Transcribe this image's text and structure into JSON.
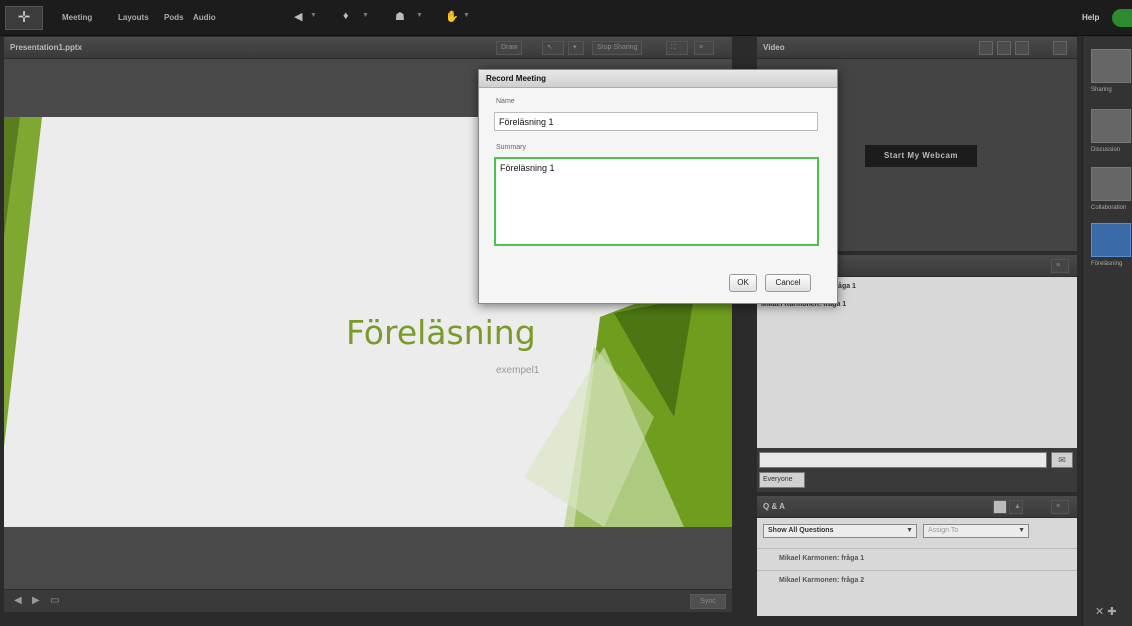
{
  "topbar": {
    "menus": [
      "Meeting",
      "Layouts",
      "Pods",
      "Audio"
    ],
    "help": "Help",
    "icons": [
      "speaker-icon",
      "microphone-icon",
      "webcam-icon",
      "raise-hand-icon"
    ]
  },
  "presentation": {
    "title": "Presentation1.pptx",
    "controls": [
      "Draw",
      "Stop Sharing",
      "Sync"
    ],
    "slide_title": "Föreläsning",
    "slide_subtitle": "exempel1",
    "accent_color": "#7a9a2a"
  },
  "video": {
    "title": "Video",
    "start_webcam": "Start My Webcam"
  },
  "chat": {
    "lines": [
      "fråga 1",
      "Mikael Karmonen: fråga 1"
    ],
    "tab": "Everyone"
  },
  "qa": {
    "title": "Q & A",
    "filter": "Show All Questions",
    "assign": "Assign To",
    "questions": [
      "Mikael Karmonen: fråga 1",
      "Mikael Karmonen: fråga 2"
    ]
  },
  "layouts": {
    "items": [
      "Sharing",
      "Discussion",
      "Collaboration",
      "Föreläsning"
    ],
    "active_color": "#3b6aa8"
  },
  "modal": {
    "title": "Record Meeting",
    "name_label": "Name",
    "name_value": "Föreläsning 1",
    "summary_label": "Summary",
    "summary_value": "Föreläsning 1",
    "ok": "OK",
    "cancel": "Cancel",
    "focus_color": "#4ac44a"
  }
}
